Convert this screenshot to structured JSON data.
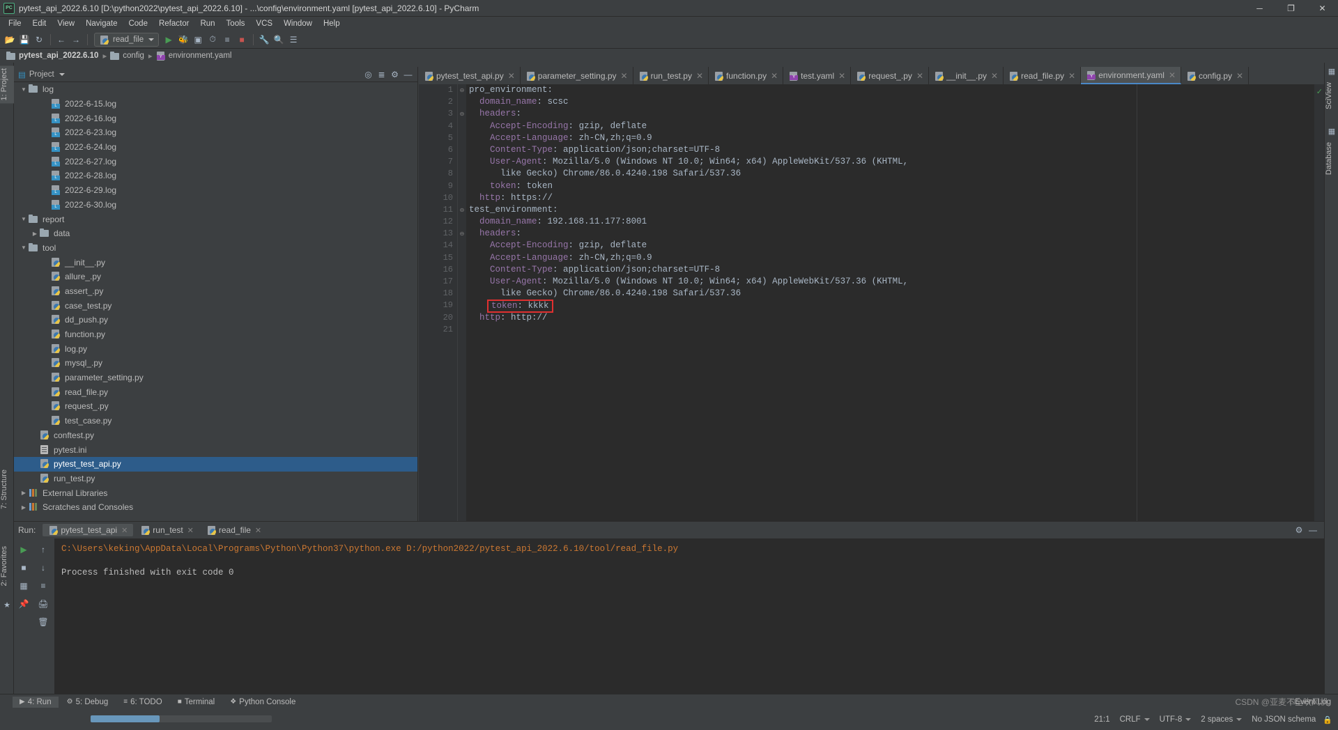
{
  "window": {
    "title": "pytest_api_2022.6.10 [D:\\python2022\\pytest_api_2022.6.10] - ...\\config\\environment.yaml [pytest_api_2022.6.10] - PyCharm",
    "app_icon_label": "PC",
    "minimize": "─",
    "maximize": "❐",
    "close": "✕"
  },
  "menu": {
    "items": [
      "File",
      "Edit",
      "View",
      "Navigate",
      "Code",
      "Refactor",
      "Run",
      "Tools",
      "VCS",
      "Window",
      "Help"
    ]
  },
  "toolbar": {
    "run_config": "read_file",
    "icons": [
      "open-folder-icon",
      "save-all-icon",
      "sync-icon",
      "back-arrow-icon",
      "forward-arrow-icon",
      "run-icon",
      "debug-icon",
      "coverage-icon",
      "profile-icon",
      "run-with-icon",
      "stop-icon",
      "wrench-icon",
      "search-icon",
      "structure-icon"
    ]
  },
  "navbar": {
    "project": "pytest_api_2022.6.10",
    "folder": "config",
    "file": "environment.yaml"
  },
  "left_strip": {
    "project_tab": "1: Project",
    "structure_tab": "7: Structure",
    "favorites_tab": "2: Favorites"
  },
  "right_strip": {
    "sciview_tab": "SciView",
    "database_tab": "Database"
  },
  "project_panel": {
    "title": "Project",
    "tools": [
      "target-icon",
      "collapse-all-icon",
      "settings-icon",
      "hide-icon"
    ],
    "tree": [
      {
        "label": "log",
        "icon": "folder",
        "indent": 1,
        "arrow": "▼",
        "selected": false
      },
      {
        "label": "2022-6-15.log",
        "icon": "log",
        "indent": 3,
        "arrow": "",
        "selected": false
      },
      {
        "label": "2022-6-16.log",
        "icon": "log",
        "indent": 3,
        "arrow": "",
        "selected": false
      },
      {
        "label": "2022-6-23.log",
        "icon": "log",
        "indent": 3,
        "arrow": "",
        "selected": false
      },
      {
        "label": "2022-6-24.log",
        "icon": "log",
        "indent": 3,
        "arrow": "",
        "selected": false
      },
      {
        "label": "2022-6-27.log",
        "icon": "log",
        "indent": 3,
        "arrow": "",
        "selected": false
      },
      {
        "label": "2022-6-28.log",
        "icon": "log",
        "indent": 3,
        "arrow": "",
        "selected": false
      },
      {
        "label": "2022-6-29.log",
        "icon": "log",
        "indent": 3,
        "arrow": "",
        "selected": false
      },
      {
        "label": "2022-6-30.log",
        "icon": "log",
        "indent": 3,
        "arrow": "",
        "selected": false
      },
      {
        "label": "report",
        "icon": "folder",
        "indent": 1,
        "arrow": "▼",
        "selected": false
      },
      {
        "label": "data",
        "icon": "folder",
        "indent": 2,
        "arrow": "▶",
        "selected": false
      },
      {
        "label": "tool",
        "icon": "folder",
        "indent": 1,
        "arrow": "▼",
        "selected": false
      },
      {
        "label": "__init__.py",
        "icon": "py",
        "indent": 3,
        "arrow": "",
        "selected": false
      },
      {
        "label": "allure_.py",
        "icon": "py",
        "indent": 3,
        "arrow": "",
        "selected": false
      },
      {
        "label": "assert_.py",
        "icon": "py",
        "indent": 3,
        "arrow": "",
        "selected": false
      },
      {
        "label": "case_test.py",
        "icon": "py",
        "indent": 3,
        "arrow": "",
        "selected": false
      },
      {
        "label": "dd_push.py",
        "icon": "py",
        "indent": 3,
        "arrow": "",
        "selected": false
      },
      {
        "label": "function.py",
        "icon": "py",
        "indent": 3,
        "arrow": "",
        "selected": false
      },
      {
        "label": "log.py",
        "icon": "py",
        "indent": 3,
        "arrow": "",
        "selected": false
      },
      {
        "label": "mysql_.py",
        "icon": "py",
        "indent": 3,
        "arrow": "",
        "selected": false
      },
      {
        "label": "parameter_setting.py",
        "icon": "py",
        "indent": 3,
        "arrow": "",
        "selected": false
      },
      {
        "label": "read_file.py",
        "icon": "py",
        "indent": 3,
        "arrow": "",
        "selected": false
      },
      {
        "label": "request_.py",
        "icon": "py",
        "indent": 3,
        "arrow": "",
        "selected": false
      },
      {
        "label": "test_case.py",
        "icon": "py",
        "indent": 3,
        "arrow": "",
        "selected": false
      },
      {
        "label": "conftest.py",
        "icon": "py",
        "indent": 2,
        "arrow": "",
        "selected": false
      },
      {
        "label": "pytest.ini",
        "icon": "ini",
        "indent": 2,
        "arrow": "",
        "selected": false
      },
      {
        "label": "pytest_test_api.py",
        "icon": "py",
        "indent": 2,
        "arrow": "",
        "selected": true
      },
      {
        "label": "run_test.py",
        "icon": "py",
        "indent": 2,
        "arrow": "",
        "selected": false
      },
      {
        "label": "External Libraries",
        "icon": "lib",
        "indent": 1,
        "arrow": "▶",
        "selected": false
      },
      {
        "label": "Scratches and Consoles",
        "icon": "lib",
        "indent": 1,
        "arrow": "▶",
        "selected": false
      }
    ]
  },
  "editor": {
    "tabs": [
      {
        "label": "pytest_test_api.py",
        "icon": "py",
        "active": false
      },
      {
        "label": "parameter_setting.py",
        "icon": "py",
        "active": false
      },
      {
        "label": "run_test.py",
        "icon": "py",
        "active": false
      },
      {
        "label": "function.py",
        "icon": "py",
        "active": false
      },
      {
        "label": "test.yaml",
        "icon": "yaml",
        "active": false
      },
      {
        "label": "request_.py",
        "icon": "py",
        "active": false
      },
      {
        "label": "__init__.py",
        "icon": "py",
        "active": false
      },
      {
        "label": "read_file.py",
        "icon": "py",
        "active": false
      },
      {
        "label": "environment.yaml",
        "icon": "yaml",
        "active": true
      },
      {
        "label": "config.py",
        "icon": "py",
        "active": false
      }
    ],
    "close_glyph": "✕",
    "line_numbers": [
      "1",
      "2",
      "3",
      "4",
      "5",
      "6",
      "7",
      "8",
      "9",
      "10",
      "11",
      "12",
      "13",
      "14",
      "15",
      "16",
      "17",
      "18",
      "19",
      "20",
      "21"
    ],
    "lines": [
      {
        "indent": 0,
        "fold": "−",
        "key": "pro_environment",
        "sep": ":",
        "value": ""
      },
      {
        "indent": 1,
        "fold": "",
        "key": "domain_name",
        "sep": ": ",
        "value": "scsc"
      },
      {
        "indent": 1,
        "fold": "−",
        "key": "headers",
        "sep": ":",
        "value": ""
      },
      {
        "indent": 2,
        "fold": "",
        "key": "Accept-Encoding",
        "sep": ": ",
        "value": "gzip, deflate"
      },
      {
        "indent": 2,
        "fold": "",
        "key": "Accept-Language",
        "sep": ": ",
        "value": "zh-CN,zh;q=0.9"
      },
      {
        "indent": 2,
        "fold": "",
        "key": "Content-Type",
        "sep": ": ",
        "value": "application/json;charset=UTF-8"
      },
      {
        "indent": 2,
        "fold": "",
        "key": "User-Agent",
        "sep": ": ",
        "value": "Mozilla/5.0 (Windows NT 10.0; Win64; x64) AppleWebKit/537.36 (KHTML,"
      },
      {
        "indent": 3,
        "fold": "",
        "key": "",
        "sep": "",
        "value": "like Gecko) Chrome/86.0.4240.198 Safari/537.36"
      },
      {
        "indent": 2,
        "fold": "",
        "key": "token",
        "sep": ": ",
        "value": "token"
      },
      {
        "indent": 1,
        "fold": "",
        "key": "http",
        "sep": ": ",
        "value": "https://"
      },
      {
        "indent": 0,
        "fold": "−",
        "key": "test_environment",
        "sep": ":",
        "value": ""
      },
      {
        "indent": 1,
        "fold": "",
        "key": "domain_name",
        "sep": ": ",
        "value": "192.168.11.177:8001"
      },
      {
        "indent": 1,
        "fold": "−",
        "key": "headers",
        "sep": ":",
        "value": ""
      },
      {
        "indent": 2,
        "fold": "",
        "key": "Accept-Encoding",
        "sep": ": ",
        "value": "gzip, deflate"
      },
      {
        "indent": 2,
        "fold": "",
        "key": "Accept-Language",
        "sep": ": ",
        "value": "zh-CN,zh;q=0.9"
      },
      {
        "indent": 2,
        "fold": "",
        "key": "Content-Type",
        "sep": ": ",
        "value": "application/json;charset=UTF-8"
      },
      {
        "indent": 2,
        "fold": "",
        "key": "User-Agent",
        "sep": ": ",
        "value": "Mozilla/5.0 (Windows NT 10.0; Win64; x64) AppleWebKit/537.36 (KHTML,"
      },
      {
        "indent": 3,
        "fold": "",
        "key": "",
        "sep": "",
        "value": "like Gecko) Chrome/86.0.4240.198 Safari/537.36"
      },
      {
        "indent": 2,
        "fold": "",
        "key": "token",
        "sep": ": ",
        "value": "kkkk",
        "highlight": true
      },
      {
        "indent": 1,
        "fold": "",
        "key": "http",
        "sep": ": ",
        "value": "http://"
      },
      {
        "indent": 0,
        "fold": "",
        "key": "",
        "sep": "",
        "value": ""
      }
    ],
    "inspection_status": "✓",
    "highlight_color": "#e03030"
  },
  "run_panel": {
    "run_label": "Run:",
    "tabs": [
      {
        "label": "pytest_test_api",
        "icon": "py",
        "active": true
      },
      {
        "label": "run_test",
        "icon": "py",
        "active": false
      },
      {
        "label": "read_file",
        "icon": "py",
        "active": false
      }
    ],
    "close_glyph": "✕",
    "tools": [
      "settings-icon",
      "hide-icon"
    ],
    "sidebar_icons": [
      "rerun-icon",
      "up-stack-icon",
      "down-stack-icon",
      "grid-icon",
      "wrap-icon",
      "print-icon",
      "trash-icon",
      "soft-wrap-icon"
    ],
    "console": {
      "command": "C:\\Users\\keking\\AppData\\Local\\Programs\\Python\\Python37\\python.exe D:/python2022/pytest_api_2022.6.10/tool/read_file.py",
      "result": "Process finished with exit code 0"
    }
  },
  "bottom_bar": {
    "tabs": [
      {
        "label": "4: Run",
        "icon": "▶",
        "active": true
      },
      {
        "label": "5: Debug",
        "icon": "⚙",
        "active": false
      },
      {
        "label": "6: TODO",
        "icon": "≡",
        "active": false
      },
      {
        "label": "Terminal",
        "icon": "■",
        "active": false
      },
      {
        "label": "Python Console",
        "icon": "❖",
        "active": false
      }
    ],
    "event_log": "Event Log"
  },
  "status_bar": {
    "caret_position": "21:1",
    "line_separator": "CRLF",
    "encoding": "UTF-8",
    "indent": "2 spaces",
    "json_schema": "No JSON schema",
    "lock_icon": "🔒"
  },
  "watermark": "CSDN @亚麦不全吹风机"
}
